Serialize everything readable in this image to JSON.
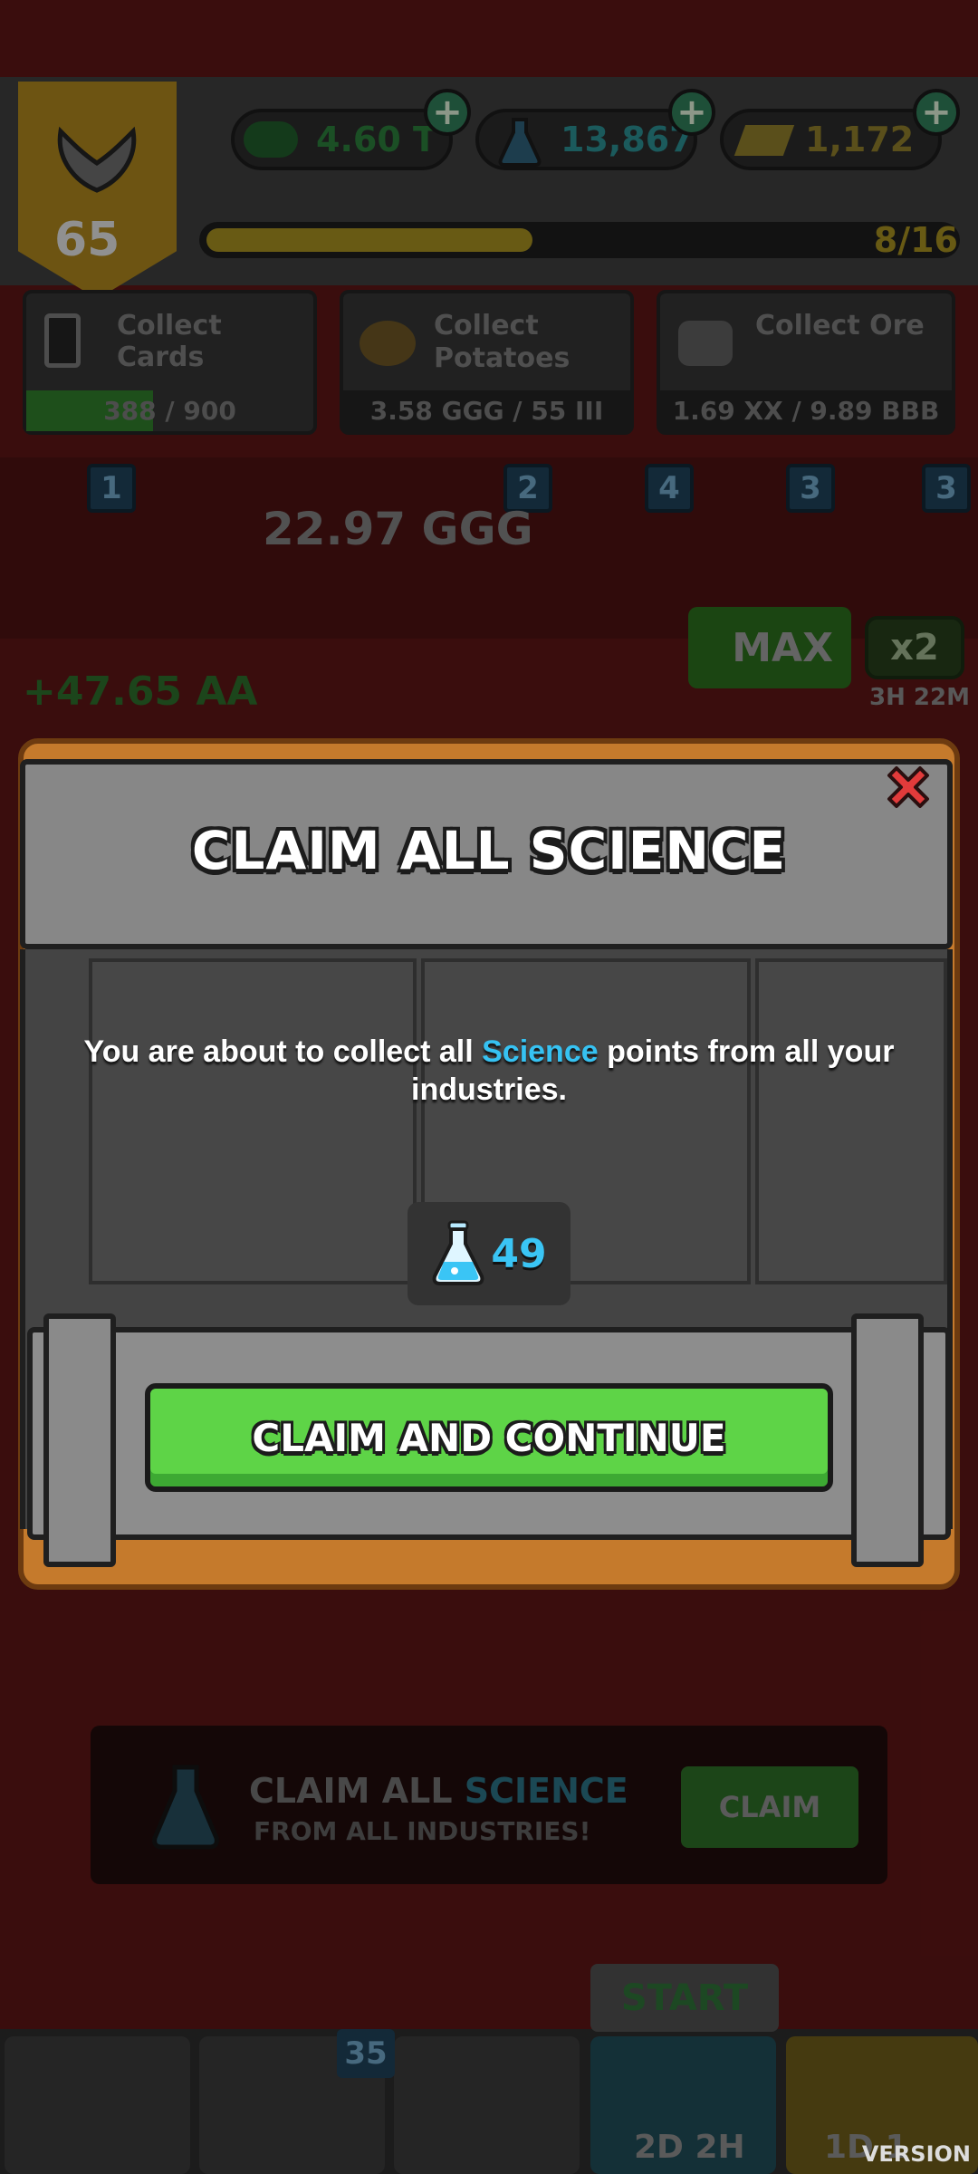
{
  "background": {
    "resources": {
      "cash": "4.60 T",
      "science": "13,867",
      "gold": "1,172"
    },
    "level": "65",
    "xp_progress": "8/16",
    "tasks": [
      {
        "label": "Collect Cards",
        "value": "388 / 900"
      },
      {
        "label": "Collect Potatoes",
        "value": "3.58 GGG / 55 III"
      },
      {
        "label": "Collect Ore",
        "value": "1.69 XX / 9.89 BBB"
      }
    ],
    "industry": {
      "badges": [
        "1",
        "2",
        "4",
        "3",
        "3"
      ],
      "amount": "22.97 GGG",
      "income": "+47.65 AA",
      "max_label": "MAX",
      "multiplier": "x2",
      "timer": "3H 22M"
    },
    "claim_row": {
      "title_part1": "CLAIM ALL ",
      "title_part2": "SCIENCE",
      "subtitle": "FROM ALL INDUSTRIES!",
      "button": "CLAIM"
    },
    "nav": {
      "cards_badge": "35",
      "start_label": "START",
      "time_left": "2D 2H",
      "time_right": "1D 1"
    },
    "version": "VERSION"
  },
  "modal": {
    "title": "CLAIM ALL SCIENCE",
    "desc_before": "You are about to collect all ",
    "desc_highlight": "Science",
    "desc_after": " points from all your industries.",
    "reward_value": "49",
    "button_label": "CLAIM AND CONTINUE"
  },
  "colors": {
    "science_blue": "#36c2f2",
    "button_green": "#5ed447",
    "close_red": "#e23b3b",
    "wood": "#c57a2c"
  },
  "icons": [
    "wings-icon",
    "cash-icon",
    "flask-icon",
    "gold-bar-icon",
    "close-icon",
    "potato-icon",
    "ore-icon",
    "card-icon"
  ]
}
